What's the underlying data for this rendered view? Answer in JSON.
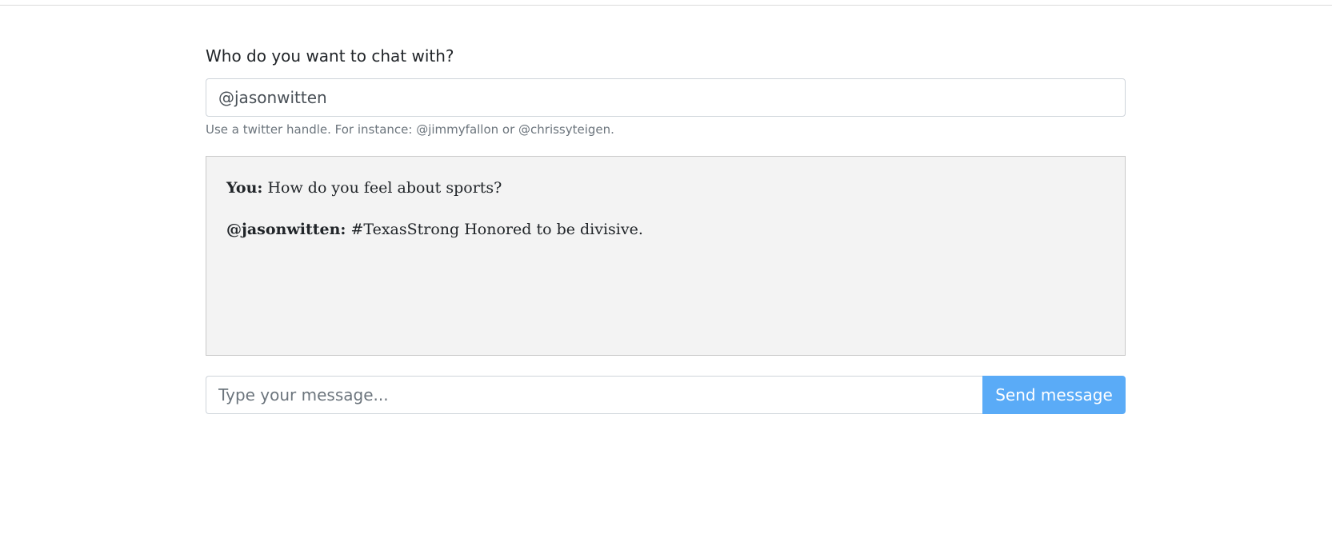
{
  "form": {
    "label": "Who do you want to chat with?",
    "handle_value": "@jasonwitten",
    "help_text": "Use a twitter handle. For instance: @jimmyfallon or @chrissyteigen."
  },
  "chat": {
    "messages": [
      {
        "sender": "You:",
        "text": "How do you feel about sports?"
      },
      {
        "sender": "@jasonwitten:",
        "text": "#TexasStrong Honored to be divisive."
      }
    ]
  },
  "composer": {
    "placeholder": "Type your message...",
    "send_label": "Send message"
  },
  "colors": {
    "accent": "#5aabf7",
    "chat_background": "#f3f3f3"
  }
}
